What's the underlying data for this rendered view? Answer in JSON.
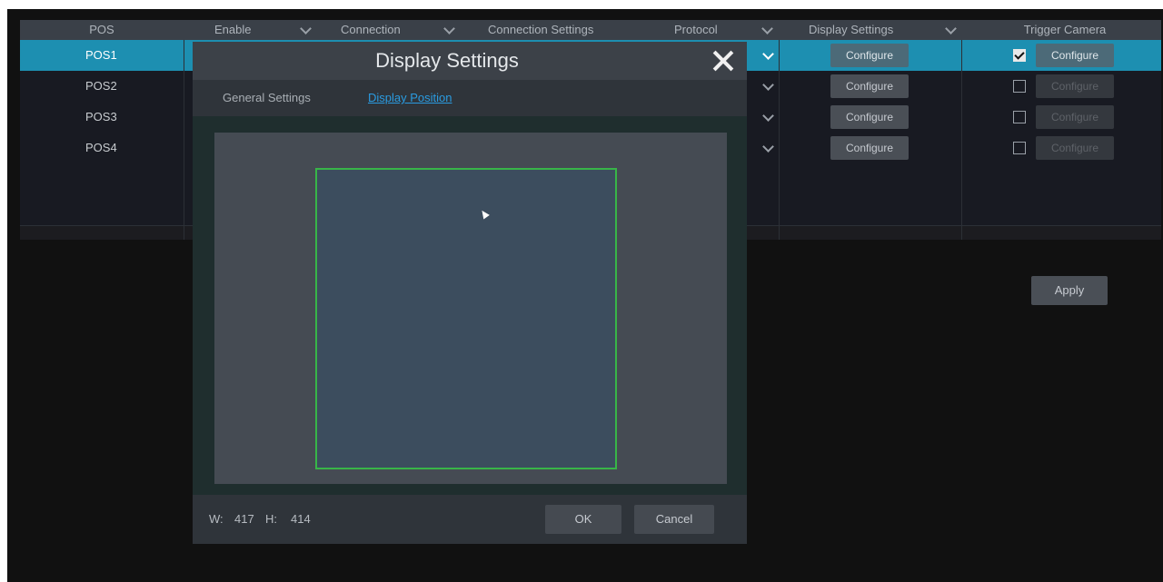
{
  "table": {
    "headers": {
      "pos": "POS",
      "enable": "Enable",
      "connection": "Connection",
      "connection_settings": "Connection Settings",
      "protocol": "Protocol",
      "display_settings": "Display Settings",
      "trigger_camera": "Trigger Camera"
    },
    "rows": [
      {
        "name": "POS1",
        "display_btn": "Configure",
        "trigger_checked": true,
        "trigger_btn": "Configure"
      },
      {
        "name": "POS2",
        "display_btn": "Configure",
        "trigger_checked": false,
        "trigger_btn": "Configure"
      },
      {
        "name": "POS3",
        "display_btn": "Configure",
        "trigger_checked": false,
        "trigger_btn": "Configure"
      },
      {
        "name": "POS4",
        "display_btn": "Configure",
        "trigger_checked": false,
        "trigger_btn": "Configure"
      }
    ],
    "apply_label": "Apply"
  },
  "dialog": {
    "title": "Display Settings",
    "tabs": {
      "general": "General Settings",
      "position": "Display Position"
    },
    "footer": {
      "w_label": "W:",
      "w_value": "417",
      "h_label": "H:",
      "h_value": "414",
      "ok_label": "OK",
      "cancel_label": "Cancel"
    }
  },
  "colors": {
    "selected_row": "#1d8fb1",
    "active_tab": "#2a9be0",
    "position_border": "#38b548"
  },
  "icons": {
    "close": "close-icon",
    "dropdown": "chevron-down-icon",
    "checkbox": "checkbox-icon",
    "pointer": "cursor-icon"
  }
}
